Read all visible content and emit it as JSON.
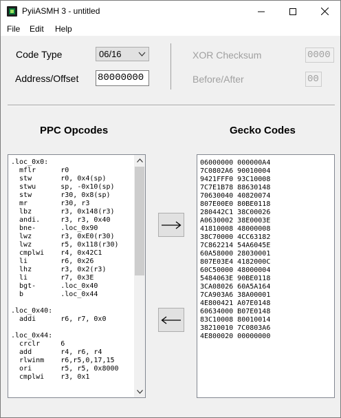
{
  "window": {
    "title": "PyiiASMH 3 - untitled",
    "minimize_glyph": "—",
    "maximize_glyph": "☐",
    "close_glyph": "✕"
  },
  "menu": {
    "items": [
      "File",
      "Edit",
      "Help"
    ]
  },
  "settings": {
    "code_type_label": "Code Type",
    "code_type_value": "06/16",
    "address_label": "Address/Offset",
    "address_value": "80000000",
    "xor_label": "XOR Checksum",
    "xor_value": "0000",
    "before_after_label": "Before/After",
    "before_after_value": "00"
  },
  "opcodes": {
    "heading": "PPC Opcodes",
    "lines": [
      ".loc_0x0:",
      "  mflr      r0",
      "  stw       r0, 0x4(sp)",
      "  stwu      sp, -0x10(sp)",
      "  stw       r30, 0x8(sp)",
      "  mr        r30, r3",
      "  lbz       r3, 0x148(r3)",
      "  andi.     r3, r3, 0x40",
      "  bne-      .loc_0x90",
      "  lwz       r3, 0xE0(r30)",
      "  lwz       r5, 0x118(r30)",
      "  cmplwi    r4, 0x42C1",
      "  li        r6, 0x26",
      "  lhz       r3, 0x2(r3)",
      "  li        r7, 0x3E",
      "  bgt-      .loc_0x40",
      "  b         .loc_0x44",
      "",
      ".loc_0x40:",
      "  addi      r6, r7, 0x0",
      "",
      ".loc_0x44:",
      "  crclr     6",
      "  add       r4, r6, r4",
      "  rlwinm    r6,r5,0,17,15",
      "  ori       r5, r5, 0x8000",
      "  cmplwi    r3, 0x1"
    ]
  },
  "gecko": {
    "heading": "Gecko Codes",
    "lines": [
      "06000000 000000A4",
      "7C0802A6 90010004",
      "9421FFF0 93C10008",
      "7C7E1B78 88630148",
      "70630040 40820074",
      "807E00E0 80BE0118",
      "280442C1 38C00026",
      "A0630002 38E0003E",
      "41810008 48000008",
      "38C70000 4CC63182",
      "7C862214 54A6045E",
      "60A58000 28030001",
      "807E03E4 4182000C",
      "60C50000 48000004",
      "5484063E 90BE0118",
      "3CA08026 60A5A164",
      "7CA903A6 38A00001",
      "4E800421 A07E0148",
      "60634000 B07E0148",
      "83C10008 80010014",
      "38210010 7C0803A6",
      "4E800020 00000000"
    ]
  },
  "buttons": {
    "assemble_glyph": "⟶",
    "disassemble_glyph": "⟵"
  }
}
